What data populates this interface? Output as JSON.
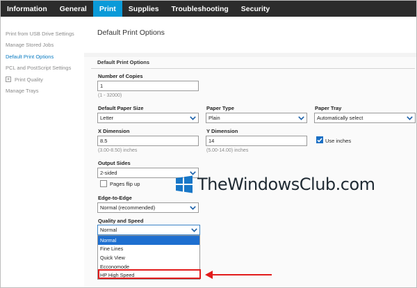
{
  "tabs": [
    {
      "label": "Information",
      "active": false
    },
    {
      "label": "General",
      "active": false
    },
    {
      "label": "Print",
      "active": true
    },
    {
      "label": "Supplies",
      "active": false
    },
    {
      "label": "Troubleshooting",
      "active": false
    },
    {
      "label": "Security",
      "active": false
    }
  ],
  "sidebar": {
    "items": [
      {
        "label": "Print from USB Drive Settings"
      },
      {
        "label": "Manage Stored Jobs"
      },
      {
        "label": "Default Print Options",
        "active": true
      },
      {
        "label": "PCL and PostScript Settings"
      },
      {
        "label": "Print Quality",
        "expandable": true,
        "expander": "+"
      },
      {
        "label": "Manage Trays"
      }
    ]
  },
  "main": {
    "title": "Default Print Options",
    "section_heading": "Default Print Options",
    "copies": {
      "label": "Number of Copies",
      "value": "1",
      "hint": "(1 - 32000)"
    },
    "paper_size": {
      "label": "Default Paper Size",
      "value": "Letter"
    },
    "paper_type": {
      "label": "Paper Type",
      "value": "Plain"
    },
    "paper_tray": {
      "label": "Paper Tray",
      "value": "Automatically select"
    },
    "x_dimension": {
      "label": "X Dimension",
      "value": "8.5",
      "hint": "(3.00-8.50) inches"
    },
    "y_dimension": {
      "label": "Y Dimension",
      "value": "14",
      "hint": "(5.00-14.00) inches"
    },
    "use_inches": {
      "label": "Use inches",
      "checked": true
    },
    "output_sides": {
      "label": "Output Sides",
      "value": "2-sided"
    },
    "pages_flip_up": {
      "label": "Pages flip up",
      "checked": false
    },
    "edge_to_edge": {
      "label": "Edge-to-Edge",
      "value": "Normal (recommended)"
    },
    "quality_speed": {
      "label": "Quality and Speed",
      "value": "Normal",
      "options": [
        "Normal",
        "Fine Lines",
        "Quick View",
        "Ecconomode",
        "HP High Speed"
      ],
      "selected_index": 0,
      "highlighted_option": "HP High Speed"
    }
  },
  "watermark": {
    "text": "TheWindowsClub.com"
  },
  "colors": {
    "tab_bar": "#2c2c2c",
    "tab_active": "#0a9ad8",
    "sidebar_active": "#0a7bc2",
    "option_selected": "#1e6fd0",
    "annotation_red": "#e21c1c",
    "chevron_blue": "#1a5fa8"
  },
  "icons": {
    "chevron": "chevron-down-icon",
    "check": "checkmark-icon",
    "arrow": "left-arrow-icon",
    "logo": "windows-logo-icon"
  }
}
